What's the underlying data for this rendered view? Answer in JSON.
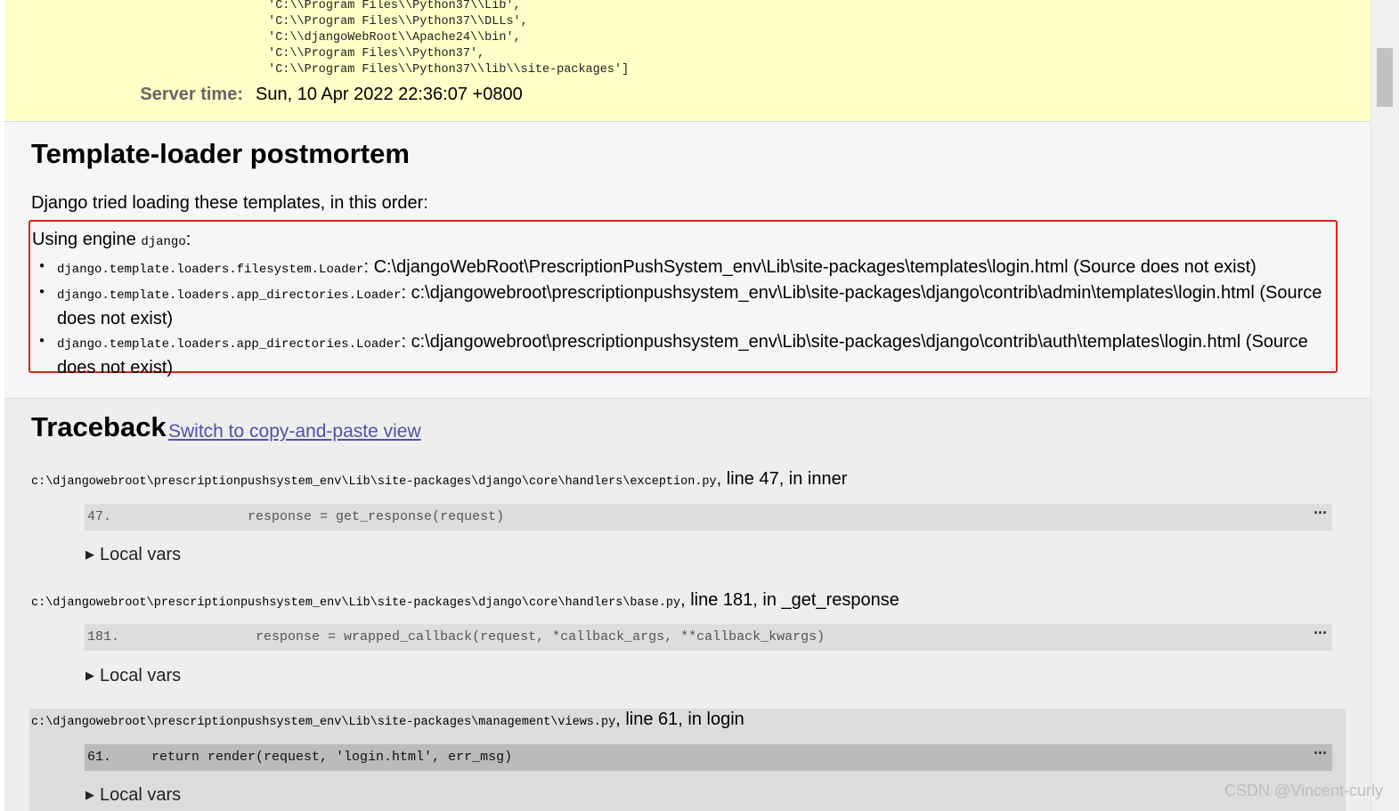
{
  "summary": {
    "sys_path_lines": [
      " 'C:\\\\Program Files\\\\Python37\\\\Lib',",
      " 'C:\\\\Program Files\\\\Python37\\\\DLLs',",
      " 'C:\\\\djangoWebRoot\\\\Apache24\\\\bin',",
      " 'C:\\\\Program Files\\\\Python37',",
      " 'C:\\\\Program Files\\\\Python37\\\\lib\\\\site-packages']"
    ],
    "server_time_label": "Server time:",
    "server_time_value": "Sun, 10 Apr 2022 22:36:07 +0800"
  },
  "template_loader": {
    "title": "Template-loader postmortem",
    "intro": "Django tried loading these templates, in this order:",
    "engine_prefix": "Using engine",
    "engine_name": "django",
    "engine_suffix": ":",
    "entries": [
      {
        "loader": "django.template.loaders.filesystem.Loader",
        "path": ": C:\\djangoWebRoot\\PrescriptionPushSystem_env\\Lib\\site-packages\\templates\\login.html (Source does not exist)"
      },
      {
        "loader": "django.template.loaders.app_directories.Loader",
        "path": ": c:\\djangowebroot\\prescriptionpushsystem_env\\Lib\\site-packages\\django\\contrib\\admin\\templates\\login.html (Source does not exist)"
      },
      {
        "loader": "django.template.loaders.app_directories.Loader",
        "path": ": c:\\djangowebroot\\prescriptionpushsystem_env\\Lib\\site-packages\\django\\contrib\\auth\\templates\\login.html (Source does not exist)"
      }
    ]
  },
  "traceback": {
    "title": "Traceback",
    "switch_link": "Switch to copy-and-paste view",
    "local_vars_label": "Local vars",
    "more_icon": "ellipsis-icon",
    "frames": [
      {
        "file": "c:\\djangowebroot\\prescriptionpushsystem_env\\Lib\\site-packages\\django\\core\\handlers\\exception.py",
        "location": ", line 47, in inner",
        "code": "47.                 response = get_response(request)"
      },
      {
        "file": "c:\\djangowebroot\\prescriptionpushsystem_env\\Lib\\site-packages\\django\\core\\handlers\\base.py",
        "location": ", line 181, in _get_response",
        "code": "181.                 response = wrapped_callback(request, *callback_args, **callback_kwargs)"
      },
      {
        "file": "c:\\djangowebroot\\prescriptionpushsystem_env\\Lib\\site-packages\\management\\views.py",
        "location": ", line 61, in login",
        "code": "61.     return render(request, 'login.html', err_msg)"
      }
    ]
  },
  "watermark": "CSDN @Vincent-curly",
  "colors": {
    "summary_bg": "#ffffc8",
    "highlight_border": "#e0201e",
    "link": "#5050aa"
  }
}
